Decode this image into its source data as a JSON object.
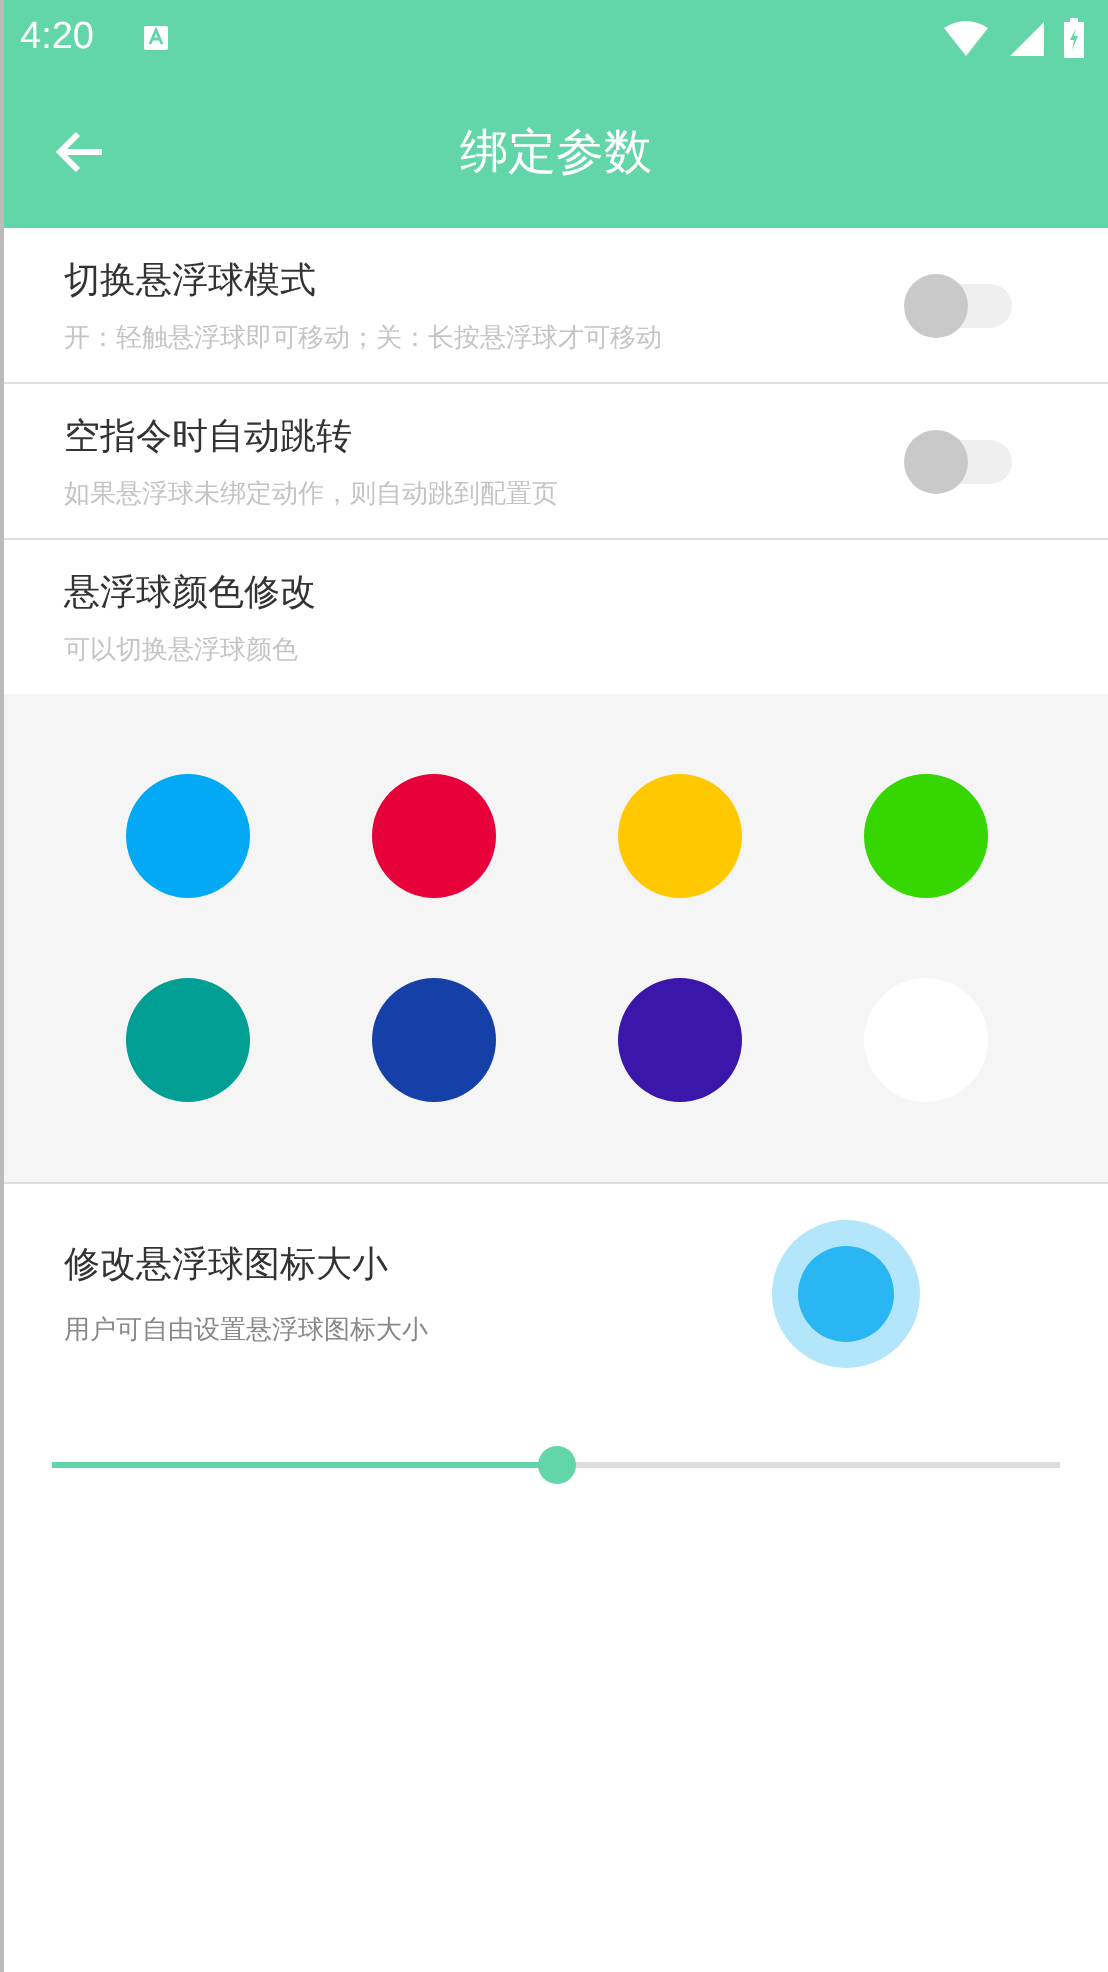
{
  "status_bar": {
    "time": "4:20"
  },
  "toolbar": {
    "title": "绑定参数"
  },
  "settings": [
    {
      "title": "切换悬浮球模式",
      "subtitle": "开：轻触悬浮球即可移动；关：长按悬浮球才可移动",
      "kind": "switch",
      "on": false
    },
    {
      "title": "空指令时自动跳转",
      "subtitle": "如果悬浮球未绑定动作，则自动跳到配置页",
      "kind": "switch",
      "on": false
    },
    {
      "title": "悬浮球颜色修改",
      "subtitle": "可以切换悬浮球颜色",
      "kind": "plain"
    }
  ],
  "colors": [
    {
      "color": "#03a9f4"
    },
    {
      "color": "#e8003a"
    },
    {
      "color": "#ffc800"
    },
    {
      "color": "#36d600"
    },
    {
      "color": "#009e93"
    },
    {
      "color": "#1540a8"
    },
    {
      "color": "#3a16ab"
    },
    {
      "color": "#ffffff"
    }
  ],
  "size": {
    "title": "修改悬浮球图标大小",
    "subtitle": "用户可自由设置悬浮球图标大小",
    "level": 0.5
  }
}
